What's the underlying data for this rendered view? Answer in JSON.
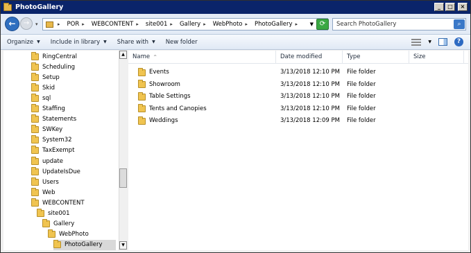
{
  "window": {
    "title": "PhotoGallery"
  },
  "address": {
    "crumbs": [
      "POR",
      "WEBCONTENT",
      "site001",
      "Gallery",
      "WebPhoto",
      "PhotoGallery"
    ]
  },
  "search": {
    "placeholder": "Search PhotoGallery"
  },
  "commands": {
    "organize": "Organize",
    "include": "Include in library",
    "share": "Share with",
    "new_folder": "New folder"
  },
  "tree": [
    {
      "label": "RingCentral",
      "indent": 0
    },
    {
      "label": "Scheduling",
      "indent": 0
    },
    {
      "label": "Setup",
      "indent": 0
    },
    {
      "label": "Skid",
      "indent": 0
    },
    {
      "label": "sql",
      "indent": 0
    },
    {
      "label": "Staffing",
      "indent": 0
    },
    {
      "label": "Statements",
      "indent": 0
    },
    {
      "label": "SWKey",
      "indent": 0
    },
    {
      "label": "System32",
      "indent": 0
    },
    {
      "label": "TaxExempt",
      "indent": 0
    },
    {
      "label": "update",
      "indent": 0
    },
    {
      "label": "UpdateIsDue",
      "indent": 0
    },
    {
      "label": "Users",
      "indent": 0
    },
    {
      "label": "Web",
      "indent": 0
    },
    {
      "label": "WEBCONTENT",
      "indent": 0
    },
    {
      "label": "site001",
      "indent": 1
    },
    {
      "label": "Gallery",
      "indent": 2
    },
    {
      "label": "WebPhoto",
      "indent": 3
    },
    {
      "label": "PhotoGallery",
      "indent": 4,
      "selected": true
    }
  ],
  "columns": {
    "name": "Name",
    "date": "Date modified",
    "type": "Type",
    "size": "Size"
  },
  "files": [
    {
      "name": "Events",
      "date": "3/13/2018 12:10 PM",
      "type": "File folder",
      "size": ""
    },
    {
      "name": "Showroom",
      "date": "3/13/2018 12:10 PM",
      "type": "File folder",
      "size": ""
    },
    {
      "name": "Table Settings",
      "date": "3/13/2018 12:10 PM",
      "type": "File folder",
      "size": ""
    },
    {
      "name": "Tents and Canopies",
      "date": "3/13/2018 12:10 PM",
      "type": "File folder",
      "size": ""
    },
    {
      "name": "Weddings",
      "date": "3/13/2018 12:09 PM",
      "type": "File folder",
      "size": ""
    }
  ]
}
